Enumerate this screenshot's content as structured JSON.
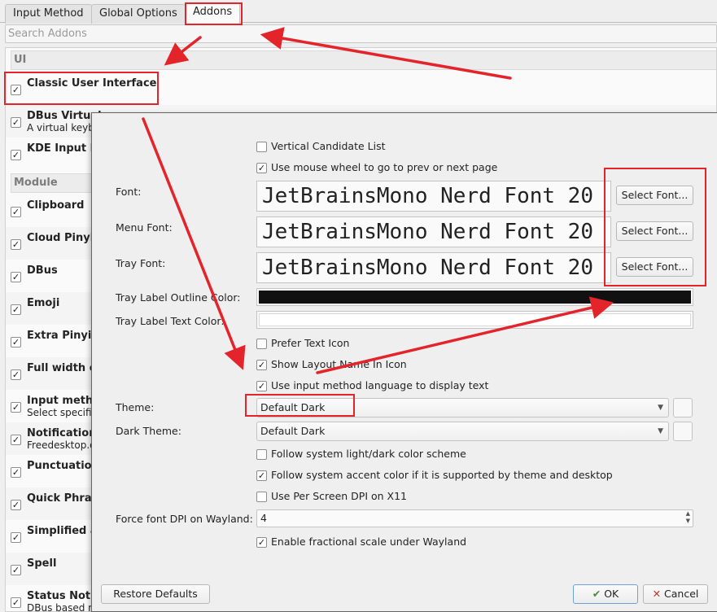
{
  "tabs": [
    {
      "label": "Input Method"
    },
    {
      "label": "Global Options"
    },
    {
      "label": "Addons"
    }
  ],
  "search": {
    "placeholder": "Search Addons"
  },
  "addons": {
    "ui_header": "UI",
    "module_header": "Module",
    "items": [
      {
        "title": "Classic User Interface",
        "sub": "",
        "checked": true
      },
      {
        "title": "DBus Virtual",
        "sub": "A virtual keyb",
        "checked": true
      },
      {
        "title": "KDE Input M",
        "sub": "",
        "checked": true
      },
      {
        "title": "Clipboard",
        "sub": "",
        "checked": true
      },
      {
        "title": "Cloud Pinyin",
        "sub": "",
        "checked": true
      },
      {
        "title": "DBus",
        "sub": "",
        "checked": true
      },
      {
        "title": "Emoji",
        "sub": "",
        "checked": true
      },
      {
        "title": "Extra Pinyin",
        "sub": "",
        "checked": true
      },
      {
        "title": "Full width c",
        "sub": "",
        "checked": true
      },
      {
        "title": "Input metho",
        "sub": "Select specifi",
        "checked": true
      },
      {
        "title": "Notification",
        "sub": "Freedesktop.o",
        "checked": true
      },
      {
        "title": "Punctuation",
        "sub": "",
        "checked": true
      },
      {
        "title": "Quick Phras",
        "sub": "",
        "checked": true
      },
      {
        "title": "Simplified a",
        "sub": "",
        "checked": true
      },
      {
        "title": "Spell",
        "sub": "",
        "checked": true
      },
      {
        "title": "Status Notif",
        "sub": "DBus based n",
        "checked": true
      }
    ]
  },
  "dialog": {
    "vertical_candidate": {
      "label": "Vertical Candidate List",
      "checked": false
    },
    "mouse_wheel": {
      "label": "Use mouse wheel to go to prev or next page",
      "checked": true
    },
    "font": {
      "label": "Font:",
      "value": "JetBrainsMono Nerd Font 20",
      "button": "Select Font..."
    },
    "menu_font": {
      "label": "Menu Font:",
      "value": "JetBrainsMono Nerd Font 20",
      "button": "Select Font..."
    },
    "tray_font": {
      "label": "Tray Font:",
      "value": "JetBrainsMono Nerd Font 20",
      "button": "Select Font..."
    },
    "tray_outline": {
      "label": "Tray Label Outline Color:",
      "color": "#111111"
    },
    "tray_text": {
      "label": "Tray Label Text Color:",
      "color": "#ffffff"
    },
    "prefer_text_icon": {
      "label": "Prefer Text Icon",
      "checked": false
    },
    "layout_name": {
      "label": "Show Layout Name In Icon",
      "checked": true
    },
    "im_language": {
      "label": "Use input method language to display text",
      "checked": true
    },
    "theme": {
      "label": "Theme:",
      "value": "Default Dark"
    },
    "dark_theme": {
      "label": "Dark Theme:",
      "value": "Default Dark"
    },
    "follow_scheme": {
      "label": "Follow system light/dark color scheme",
      "checked": false
    },
    "follow_accent": {
      "label": "Follow system accent color if it is supported by theme and desktop",
      "checked": true
    },
    "per_screen_dpi": {
      "label": "Use Per Screen DPI on X11",
      "checked": false
    },
    "force_dpi": {
      "label": "Force font DPI on Wayland:",
      "value": "4"
    },
    "fractional": {
      "label": "Enable fractional scale under Wayland",
      "checked": true
    },
    "restore_button": "Restore Defaults",
    "ok_button": "OK",
    "cancel_button": "Cancel"
  },
  "annotation_color": "#e3242b"
}
